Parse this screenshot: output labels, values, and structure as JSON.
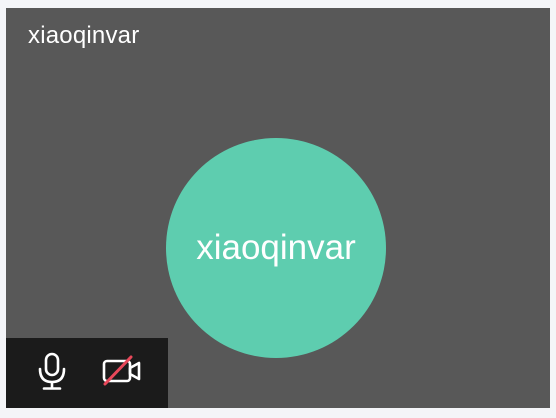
{
  "participant": {
    "name": "xiaoqinvar",
    "avatar_text": "xiaoqinvar",
    "avatar_color": "#5ecdaf"
  },
  "controls": {
    "microphone": {
      "icon": "microphone-icon",
      "state": "on"
    },
    "camera": {
      "icon": "camera-off-icon",
      "state": "off",
      "slash_color": "#e8485a"
    }
  },
  "colors": {
    "tile_background": "#585858",
    "controls_background": "#1b1b1b",
    "page_background": "#f4f5f8"
  }
}
